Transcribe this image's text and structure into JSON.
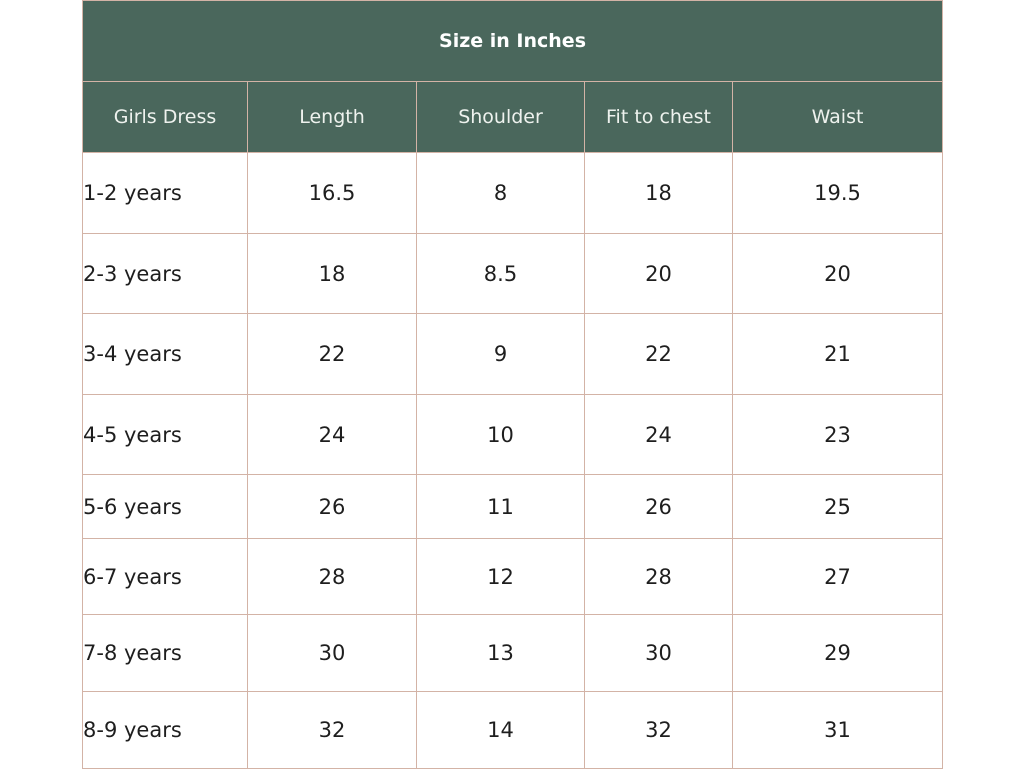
{
  "table": {
    "title": "Size in Inches",
    "headers": [
      "Girls Dress",
      "Length",
      "Shoulder",
      "Fit to chest",
      "Waist"
    ],
    "rows": [
      [
        "1-2 years",
        "16.5",
        "8",
        "18",
        "19.5"
      ],
      [
        "2-3 years",
        "18",
        "8.5",
        "20",
        "20"
      ],
      [
        "3-4 years",
        "22",
        "9",
        "22",
        "21"
      ],
      [
        "4-5 years",
        "24",
        "10",
        "24",
        "23"
      ],
      [
        "5-6 years",
        "26",
        "11",
        "26",
        "25"
      ],
      [
        "6-7 years",
        "28",
        "12",
        "28",
        "27"
      ],
      [
        "7-8 years",
        "30",
        "13",
        "30",
        "29"
      ],
      [
        "8-9 years",
        "32",
        "14",
        "32",
        "31"
      ]
    ]
  },
  "colors": {
    "header_bg": "#4a675c",
    "border": "#d3b3a6"
  }
}
